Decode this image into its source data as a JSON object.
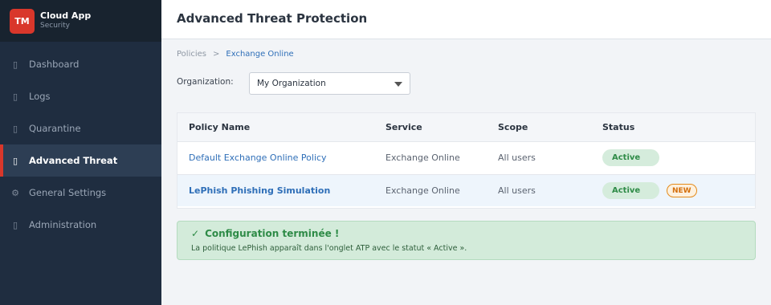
{
  "brand": {
    "logo": "TM",
    "name": "Cloud App",
    "subtitle": "Security"
  },
  "sidebar": {
    "items": [
      {
        "label": "Dashboard",
        "icon": "dashboard-icon",
        "glyph": "▯",
        "active": false
      },
      {
        "label": "Logs",
        "icon": "logs-icon",
        "glyph": "▯",
        "active": false
      },
      {
        "label": "Quarantine",
        "icon": "quarantine-icon",
        "glyph": "▯",
        "active": false
      },
      {
        "label": "Advanced Threat",
        "icon": "advanced-threat-icon",
        "glyph": "▯",
        "active": true
      },
      {
        "label": "General Settings",
        "icon": "gear-icon",
        "glyph": "⚙",
        "active": false
      },
      {
        "label": "Administration",
        "icon": "administration-icon",
        "glyph": "▯",
        "active": false
      }
    ]
  },
  "header": {
    "title": "Advanced Threat Protection"
  },
  "breadcrumb": {
    "items": [
      "Policies",
      "Exchange Online"
    ],
    "separator": ">"
  },
  "organization": {
    "label": "Organization:",
    "selected": "My Organization"
  },
  "table": {
    "columns": [
      "Policy Name",
      "Service",
      "Scope",
      "Status"
    ],
    "rows": [
      {
        "name": "Default Exchange Online Policy",
        "service": "Exchange Online",
        "scope": "All users",
        "status": "Active",
        "badge": ""
      },
      {
        "name": "LePhish Phishing Simulation",
        "service": "Exchange Online",
        "scope": "All users",
        "status": "Active",
        "badge": "NEW"
      }
    ]
  },
  "alert": {
    "check": "✓",
    "title": "Configuration terminée !",
    "message": "La politique LePhish apparaît dans l'onglet ATP avec le statut « Active »."
  },
  "colors": {
    "accent": "#d9372b",
    "sidebar": "#1f2d40",
    "link": "#2f6fb8",
    "success": "#2e8b47",
    "new_badge": "#e48a1a"
  }
}
